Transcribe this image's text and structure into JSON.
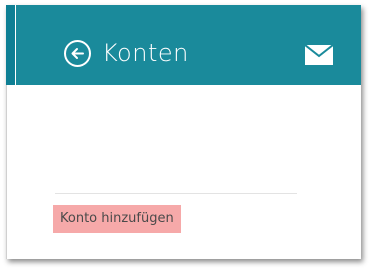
{
  "header": {
    "title": "Konten",
    "back_icon": "arrow-left-circle-icon",
    "mail_icon": "envelope-icon"
  },
  "main": {
    "add_account_label": "Konto hinzufügen"
  },
  "colors": {
    "header_bg": "#1a8a9b",
    "accent_strip": "#0e7f94",
    "add_account_bg": "#f6a9a9"
  }
}
